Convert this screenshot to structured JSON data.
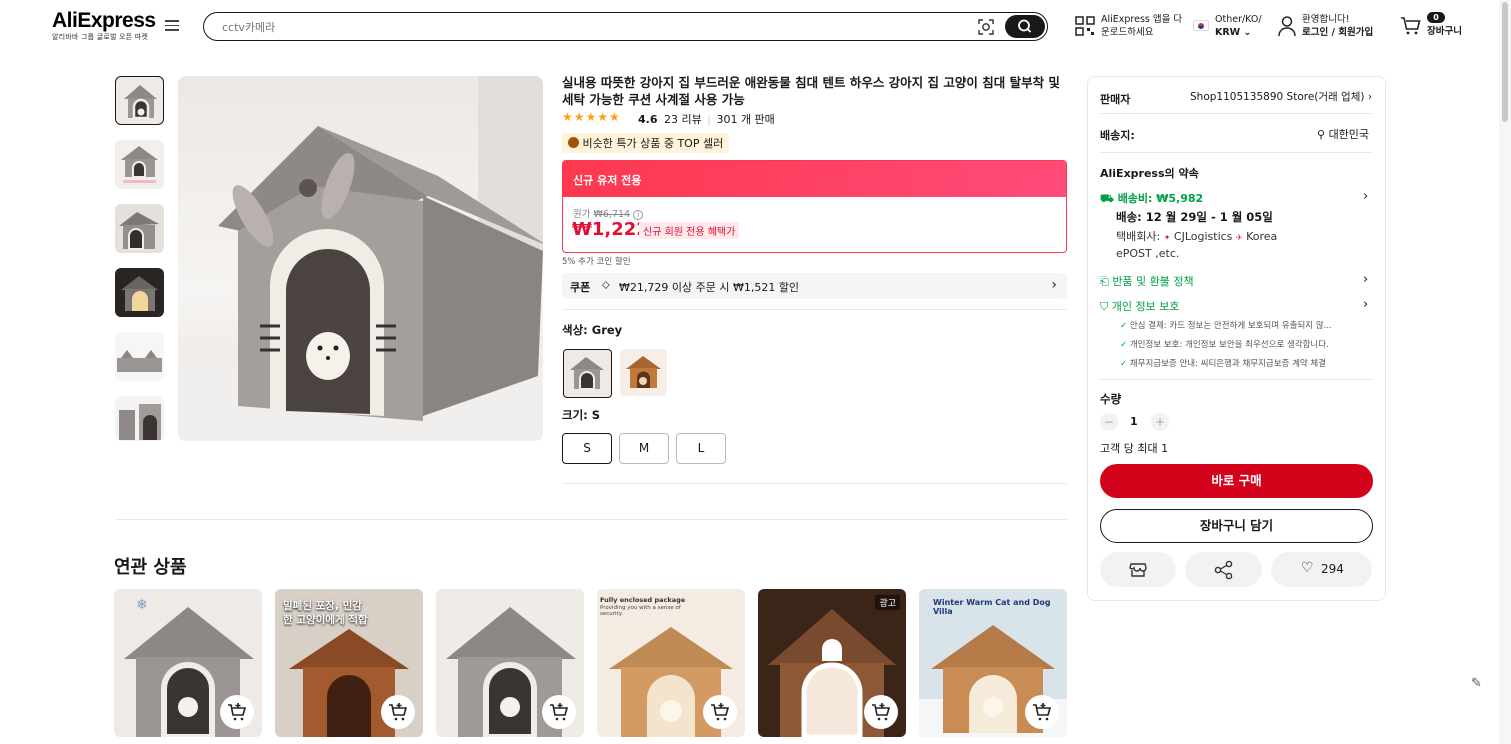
{
  "header": {
    "logo": "AliExpress",
    "logo_sub": "알리바바 그룹 글로벌 오픈 마켓",
    "search_placeholder": "cctv카메라",
    "app_line1": "AliExpress 앱을 다",
    "app_line2": "운로드하세요",
    "locale_line1": "Other/KO/",
    "locale_line2": "KRW",
    "welcome": "환영합니다!",
    "login": "로그인 / 회원가입",
    "cart_count": "0",
    "cart_label": "장바구니"
  },
  "product": {
    "title": "실내용 따뜻한 강아지 집 부드러운 애완동물 침대 텐트 하우스 강아지 집 고양이 침대 탈부착 및 세탁 가능한 쿠션 사계절 사용 가능",
    "rating": "4.6",
    "reviews": "23 리뷰",
    "sold": "301 개 판매",
    "top_seller": "비슷한 특가 상품 중 TOP 셀러",
    "new_user_label": "신규 유저 전용",
    "original_price_label": "원가",
    "original_price": "₩6,714",
    "price": "₩1,222",
    "new_member_benefit": "신규 회원 전용 혜택가",
    "coin_discount": "5% 추가 코인 할인",
    "coupon_tag": "쿠폰",
    "coupon_text": "₩21,729 이상 주문 시 ₩1,521 할인",
    "color_label": "색상: Grey",
    "size_label": "크기: S",
    "sizes": [
      "S",
      "M",
      "L"
    ],
    "selected_size_index": 0
  },
  "panel": {
    "seller_label": "판매자",
    "seller_name": "Shop1105135890 Store(거래 업체)",
    "ship_to_label": "배송지:",
    "ship_to": "대한민국",
    "promise_title": "AliExpress의 약속",
    "shipping_fee": "배송비: ₩5,982",
    "delivery": "배송: 12 월 29일 - 1 월 05일",
    "carrier_prefix": "택배회사:",
    "carrier_1": "CJLogistics",
    "carrier_2": "Korea",
    "carrier_3": "ePOST ,etc.",
    "return_policy": "반품 및 환불 정책",
    "privacy": "개인 정보 보호",
    "privacy_items": [
      "안심 결제: 카드 정보는 안전하게 보호되며 유출되지 않...",
      "개인정보 보호: 개인정보 보안을 최우선으로 생각합니다.",
      "채무지급보증 안내: 씨티은행과 채무지급보증 계약 체결"
    ],
    "quantity_label": "수량",
    "quantity": "1",
    "max_per_customer": "고객 당 최대 1",
    "buy_now": "바로 구매",
    "add_to_cart": "장바구니 담기",
    "wishlist_count": "294"
  },
  "related": {
    "title": "연관 상품",
    "ad_badge": "광고",
    "card2_caption": "밀폐된 포장, 민감\n한 고양이에게 적합",
    "card4_caption": "Fully enclosed package",
    "card4_sub": "Providing you with a sense of security.",
    "card6_caption": "Winter Warm Cat and Dog Villa"
  },
  "colors": {
    "accent": "#fd384f",
    "buy": "#d3031c",
    "green": "#00a046",
    "star": "#fc9f15"
  }
}
